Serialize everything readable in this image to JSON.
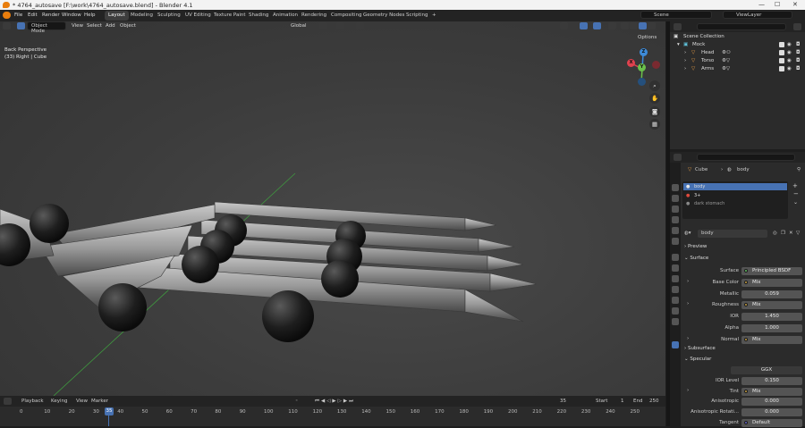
{
  "window": {
    "title": "* 4764_autosave [F:\\work\\4764_autosave.blend] - Blender 4.1",
    "controls": [
      "—",
      "☐",
      "✕"
    ]
  },
  "menubar": {
    "items": [
      "File",
      "Edit",
      "Render",
      "Window",
      "Help"
    ]
  },
  "workspaces": {
    "tabs": [
      "Layout",
      "Modeling",
      "Sculpting",
      "UV Editing",
      "Texture Paint",
      "Shading",
      "Animation",
      "Rendering",
      "Compositing",
      "Geometry Nodes",
      "Scripting"
    ],
    "add": "+",
    "active": "Layout"
  },
  "scene": {
    "label": "Scene",
    "viewlayer": "ViewLayer"
  },
  "viewport": {
    "mode": "Object Mode",
    "menu": [
      "View",
      "Select",
      "Add",
      "Object"
    ],
    "transform_orientation": "Global",
    "options_label": "Options",
    "overlay_line1": "Back Perspective",
    "overlay_line2": "(33) Right | Cube",
    "gizmo": {
      "x": "X",
      "y": "Y",
      "z": "Z"
    },
    "nav_icons": [
      "zoom-icon",
      "hand-icon",
      "camera-icon",
      "grid-icon"
    ]
  },
  "timeline": {
    "menu": [
      "Playback",
      "Keying",
      "View",
      "Marker"
    ],
    "current_frame": "35",
    "start_label": "Start",
    "start": "1",
    "end_label": "End",
    "end": "250",
    "playhead": "35",
    "ticks": [
      "0",
      "10",
      "20",
      "30",
      "40",
      "50",
      "60",
      "70",
      "80",
      "90",
      "100",
      "110",
      "120",
      "130",
      "140",
      "150",
      "160",
      "170",
      "180",
      "190",
      "200",
      "210",
      "220",
      "230",
      "240",
      "250"
    ]
  },
  "outliner": {
    "root": "Scene Collection",
    "collection": "Mock",
    "items": [
      "Head",
      "Torso",
      "Arms"
    ]
  },
  "properties": {
    "breadcrumb": {
      "object": "Cube",
      "material": "body"
    },
    "material_slots": [
      {
        "name": "body",
        "color": "#4772b3",
        "selected": true
      },
      {
        "name": "3+",
        "color": "#e04a3c",
        "selected": false
      },
      {
        "name": "dark stomach",
        "color": "#888888",
        "selected": false
      }
    ],
    "material_name": "body",
    "sections": {
      "preview": "Preview",
      "surface": "Surface",
      "subsurface": "Subsurface",
      "specular": "Specular"
    },
    "fields": [
      {
        "label": "Surface",
        "value": "Principled BSDF",
        "kind": "link"
      },
      {
        "label": "Base Color",
        "value": "Mix",
        "kind": "link"
      },
      {
        "label": "Metallic",
        "value": "0.059",
        "kind": "num"
      },
      {
        "label": "Roughness",
        "value": "Mix",
        "kind": "link"
      },
      {
        "label": "IOR",
        "value": "1.450",
        "kind": "num"
      },
      {
        "label": "Alpha",
        "value": "1.000",
        "kind": "num"
      },
      {
        "label": "Normal",
        "value": "Mix",
        "kind": "link"
      }
    ],
    "specular_fields": [
      {
        "label": "",
        "value": "GGX",
        "kind": "select"
      },
      {
        "label": "IOR Level",
        "value": "0.150",
        "kind": "num"
      },
      {
        "label": "Tint",
        "value": "Mix",
        "kind": "link"
      },
      {
        "label": "Anisotropic",
        "value": "0.000",
        "kind": "num"
      },
      {
        "label": "Anisotropic Rotati...",
        "value": "0.000",
        "kind": "num"
      },
      {
        "label": "Tangent",
        "value": "Default",
        "kind": "link"
      }
    ]
  },
  "colors": {
    "accent": "#4772b3",
    "axis_x": "#e0424e",
    "axis_y": "#6ac14b",
    "axis_z": "#3d8bd9"
  }
}
